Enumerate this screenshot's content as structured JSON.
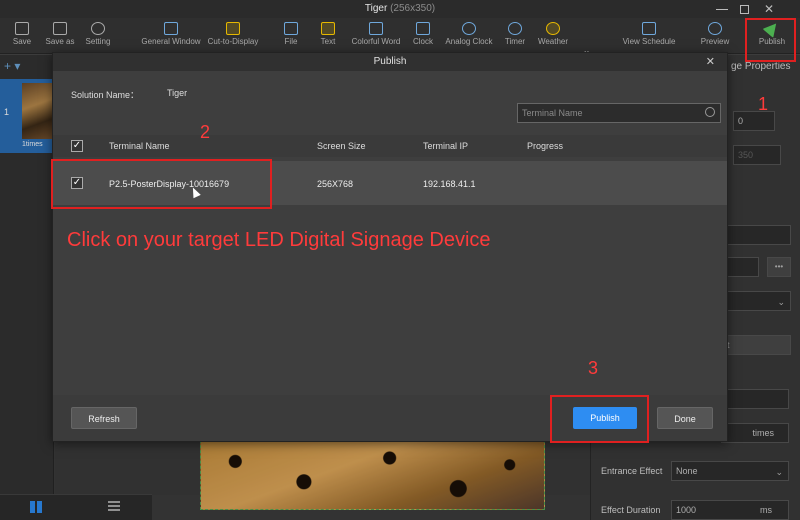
{
  "window": {
    "title": "Tiger",
    "size_hint": "(256x350)"
  },
  "toolbar": {
    "items": [
      {
        "label": "Save",
        "icon": "save-icon"
      },
      {
        "label": "Save as",
        "icon": "save-as-icon"
      },
      {
        "label": "Setting",
        "icon": "gear-icon"
      },
      {
        "label": "General Window",
        "icon": "window-icon"
      },
      {
        "label": "Cut-to-Display",
        "icon": "cut-display-icon"
      },
      {
        "label": "File",
        "icon": "file-icon"
      },
      {
        "label": "Text",
        "icon": "text-icon"
      },
      {
        "label": "Colorful Word",
        "icon": "colorful-word-icon"
      },
      {
        "label": "Clock",
        "icon": "clock-icon"
      },
      {
        "label": "Analog Clock",
        "icon": "analog-clock-icon"
      },
      {
        "label": "Timer",
        "icon": "timer-icon"
      },
      {
        "label": "Weather",
        "icon": "weather-icon"
      },
      {
        "label": "View Schedule",
        "icon": "calendar-icon"
      },
      {
        "label": "Preview",
        "icon": "eye-icon"
      },
      {
        "label": "Publish",
        "icon": "publish-icon"
      }
    ],
    "more": "»"
  },
  "left_panel": {
    "add": "+ ▾",
    "page_number": "1",
    "page_times": "1times"
  },
  "right_panel": {
    "title": "ge Properties",
    "field_a": "0",
    "field_b": "350",
    "btn_dots": "•••",
    "btn_set": "et",
    "times_label": "times",
    "entrance_effect_label": "Entrance Effect",
    "entrance_effect_value": "None",
    "effect_duration_label": "Effect Duration",
    "effect_duration_value": "1000",
    "effect_duration_unit": "ms"
  },
  "dialog": {
    "title": "Publish",
    "solution_name_label": "Solution Name：",
    "solution_name_value": "Tiger",
    "search_placeholder": "Terminal Name",
    "columns": [
      "Terminal Name",
      "Screen Size",
      "Terminal IP",
      "Progress"
    ],
    "rows": [
      {
        "checked": true,
        "terminal_name": "P2.5-PosterDisplay-10016679",
        "screen_size": "256X768",
        "terminal_ip": "192.168.41.1",
        "progress": ""
      }
    ],
    "buttons": {
      "refresh": "Refresh",
      "publish": "Publish",
      "done": "Done"
    }
  },
  "annotations": {
    "instruction": "Click on your target LED Digital Signage Device",
    "step1": "1",
    "step2": "2",
    "step3": "3",
    "color": "#e02020"
  }
}
